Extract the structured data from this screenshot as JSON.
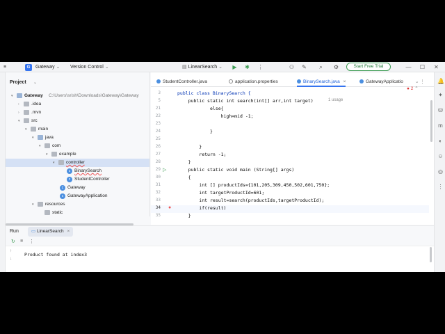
{
  "titlebar": {
    "app_badge": "G",
    "project": "Gateway",
    "vcs": "Version Control",
    "run_config": "LinearSearch",
    "trial_button": "Start Free Trial"
  },
  "project_panel": {
    "title": "Project",
    "tree": [
      {
        "label": "Gateway",
        "path": "C:\\Users\\srish\\Downloads\\Gateway\\Gateway"
      },
      {
        "label": ".idea"
      },
      {
        "label": ".mvn"
      },
      {
        "label": "src"
      },
      {
        "label": "main"
      },
      {
        "label": "java"
      },
      {
        "label": "com"
      },
      {
        "label": "example"
      },
      {
        "label": "controller"
      },
      {
        "label": "BinarySearch"
      },
      {
        "label": "StudentController"
      },
      {
        "label": "Gateway"
      },
      {
        "label": "GatewayApplication"
      },
      {
        "label": "resources"
      },
      {
        "label": "static"
      }
    ]
  },
  "editor": {
    "tabs": [
      {
        "label": "StudentController.java"
      },
      {
        "label": "application.properties"
      },
      {
        "label": "BinarySearch.java"
      },
      {
        "label": "GatewayApplicatio"
      }
    ],
    "error_count": "2",
    "lines": [
      {
        "num": "3",
        "text": "public class BinarySearch {"
      },
      {
        "num": "5",
        "text": "    public static int search(int[] arr,int target)",
        "hint": "1 usage"
      },
      {
        "num": "21",
        "text": "            else{"
      },
      {
        "num": "22",
        "text": "                high=mid -1;"
      },
      {
        "num": "23",
        "text": ""
      },
      {
        "num": "24",
        "text": "            }"
      },
      {
        "num": "25",
        "text": ""
      },
      {
        "num": "26",
        "text": "        }"
      },
      {
        "num": "27",
        "text": "        return -1;"
      },
      {
        "num": "28",
        "text": "    }"
      },
      {
        "num": "29",
        "text": "    public static void main (String[] args)"
      },
      {
        "num": "30",
        "text": "    {"
      },
      {
        "num": "31",
        "text": "        int [] productIds={101,205,309,450,502,601,750};"
      },
      {
        "num": "32",
        "text": "        int targetProductId=601;"
      },
      {
        "num": "33",
        "text": "        int result=search(productIds,targetProductId);"
      },
      {
        "num": "34",
        "text": "        if(result)"
      },
      {
        "num": "35",
        "text": "    }"
      }
    ]
  },
  "run_panel": {
    "title": "Run",
    "tab": "LinearSearch",
    "output": "Product found at index3"
  },
  "colors": {
    "accent": "#3574f0",
    "selection": "#d5e1f5",
    "keyword": "#0033b3",
    "number": "#1750eb",
    "error": "#dd3333",
    "run_green": "#3e9c54"
  }
}
